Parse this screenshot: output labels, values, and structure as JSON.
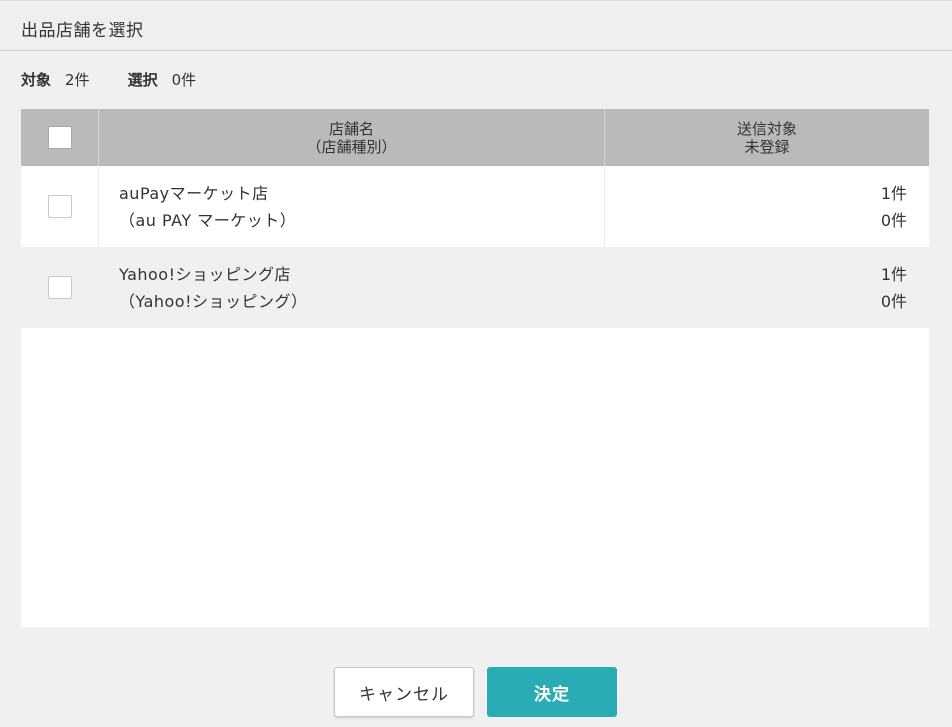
{
  "dialog": {
    "title": "出品店舗を選択"
  },
  "counts": {
    "target_label": "対象",
    "target_value": "2件",
    "selected_label": "選択",
    "selected_value": "0件"
  },
  "table": {
    "headers": {
      "name_line1": "店舗名",
      "name_line2": "（店舗種別）",
      "status_line1": "送信対象",
      "status_line2": "未登録"
    },
    "rows": [
      {
        "name": "auPayマーケット店",
        "type": "（au PAY マーケット）",
        "send_target": "1件",
        "unregistered": "0件",
        "checked": false
      },
      {
        "name": "Yahoo!ショッピング店",
        "type": "（Yahoo!ショッピング）",
        "send_target": "1件",
        "unregistered": "0件",
        "checked": false
      }
    ]
  },
  "buttons": {
    "cancel_label": "キャンセル",
    "confirm_label": "決定"
  },
  "colors": {
    "accent": "#2aacb4",
    "header_bg": "#bababa",
    "page_bg": "#f0f0f0"
  }
}
